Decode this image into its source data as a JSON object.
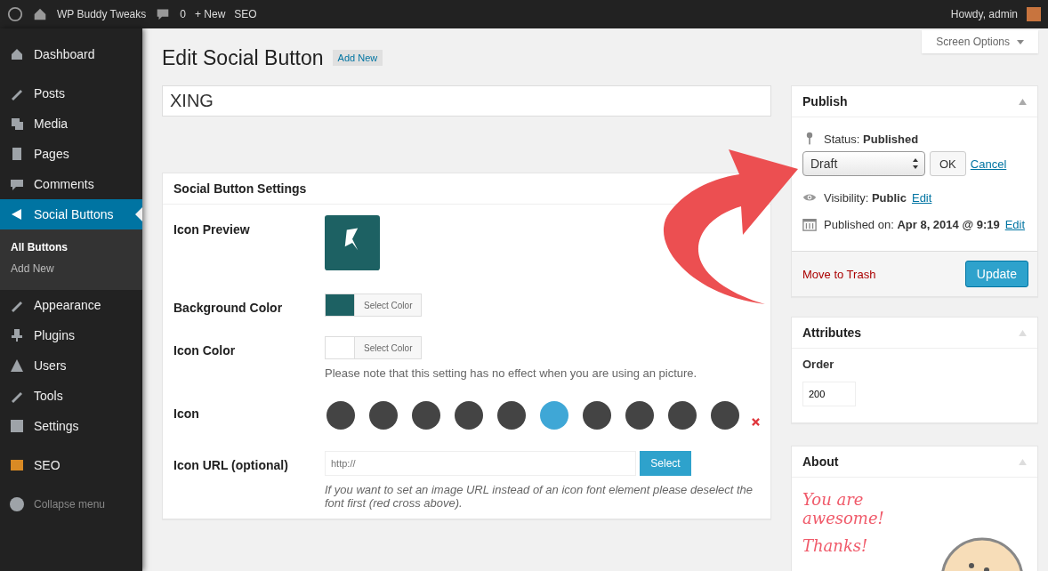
{
  "admin_bar": {
    "site_name": "WP Buddy Tweaks",
    "comments": "0",
    "new": "+ New",
    "seo": "SEO",
    "greeting": "Howdy, admin"
  },
  "sidebar": {
    "sections": [
      {
        "items": [
          {
            "label": "Dashboard",
            "selected": false
          }
        ]
      },
      {
        "items": [
          {
            "label": "Posts",
            "selected": false
          },
          {
            "label": "Media",
            "selected": false
          },
          {
            "label": "Pages",
            "selected": false
          },
          {
            "label": "Comments",
            "selected": false
          },
          {
            "label": "Social Buttons",
            "selected": true,
            "children": [
              {
                "label": "All Buttons",
                "selected": true
              },
              {
                "label": "Add New",
                "selected": false
              }
            ]
          },
          {
            "label": "Appearance",
            "selected": false
          },
          {
            "label": "Plugins",
            "selected": false
          },
          {
            "label": "Users",
            "selected": false
          },
          {
            "label": "Tools",
            "selected": false
          },
          {
            "label": "Settings",
            "selected": false
          }
        ]
      },
      {
        "items": [
          {
            "label": "SEO",
            "selected": false
          }
        ]
      }
    ],
    "collapse": "Collapse menu"
  },
  "screen_options": "Screen Options",
  "page_title": "Edit Social Button",
  "add_new": "Add New",
  "title_field": {
    "value": "XING"
  },
  "settings_box": {
    "title": "Social Button Settings",
    "icon_preview_label": "Icon Preview",
    "color_fields": [
      {
        "label": "Background Color",
        "color": "#1d6163",
        "button": "Select Color"
      },
      {
        "label": "Icon Color",
        "color": "#ffffff",
        "button": "Select Color",
        "note": "Please note that this setting has no effect when you are using an picture."
      }
    ],
    "icon_label": "Icon",
    "icons": [
      {
        "selected": false
      },
      {
        "selected": false
      },
      {
        "selected": false
      },
      {
        "selected": false
      },
      {
        "selected": false
      },
      {
        "selected": true
      },
      {
        "selected": false
      },
      {
        "selected": false
      },
      {
        "selected": false
      },
      {
        "selected": false
      }
    ],
    "url_label": "Icon URL (optional)",
    "url_placeholder": "http://",
    "url_button": "Select",
    "url_note": "If you want to set an image URL instead of an icon font element please deselect the font first (red cross above)."
  },
  "publish": {
    "title": "Publish",
    "status": "Status: **Published**",
    "status_select": "Draft",
    "ok": "OK",
    "cancel": "Cancel",
    "visibility": "Visibility: **Public**",
    "visibility_edit": "Edit",
    "published_on": "Published on: **Apr 8, 2014 @ 9:19**",
    "published_edit": "Edit",
    "trash": "Move to Trash",
    "update": "Update"
  },
  "attributes": {
    "title": "Attributes",
    "order_label": "Order",
    "order_value": "200"
  },
  "about": {
    "title": "About",
    "lines": [
      "You are awesome!",
      "Thanks!"
    ]
  }
}
